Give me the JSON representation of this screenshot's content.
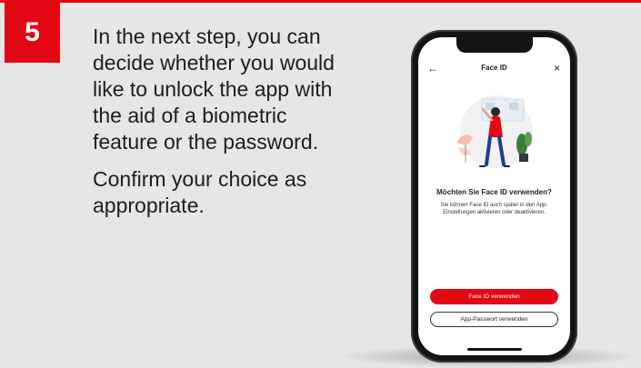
{
  "step": {
    "number": "5"
  },
  "instructions": {
    "paragraph_1": "In the next step, you can decide whether you would like to unlock the app with the aid of a biometric feature or the password.",
    "paragraph_2": "Confirm your choice as appropriate."
  },
  "phone_screen": {
    "nav": {
      "back_icon": "arrow-left-icon",
      "back_glyph": "←",
      "title": "Face ID",
      "close_icon": "close-icon",
      "close_glyph": "×"
    },
    "heading": "Möchten Sie Face ID verwenden?",
    "description": "Sie können Face ID auch später in den App-Einstellungen aktivieren oder deaktivieren.",
    "primary_button": "Face ID verwenden",
    "secondary_button": "App-Passwort verwenden"
  },
  "colors": {
    "accent": "#e30613",
    "background": "#e6e6e6",
    "text": "#1d1d1d"
  }
}
